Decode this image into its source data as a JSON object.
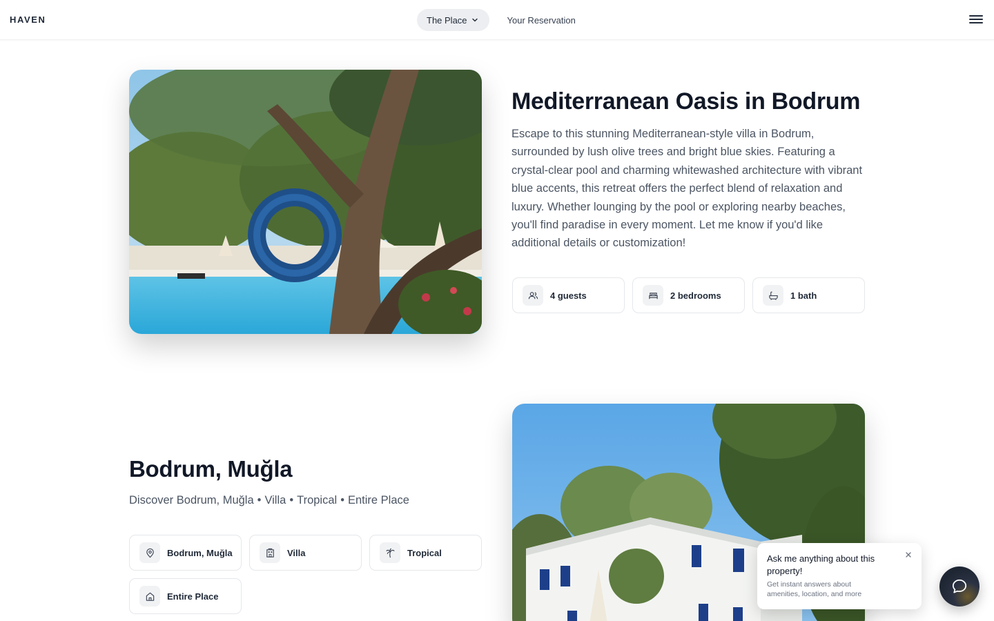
{
  "header": {
    "brand": "HAVEN",
    "nav": [
      {
        "label": "The Place",
        "active": true,
        "icon": "chevron-down-icon"
      },
      {
        "label": "Your Reservation",
        "active": false
      }
    ],
    "menu_icon": "hamburger-menu-icon"
  },
  "listing": {
    "title": "Mediterranean Oasis in Bodrum",
    "description": "Escape to this stunning Mediterranean-style villa in Bodrum, surrounded by lush olive trees and bright blue skies. Featuring a crystal-clear pool and charming whitewashed architecture with vibrant blue accents, this retreat offers the perfect blend of relaxation and luxury. Whether lounging by the pool or exploring nearby beaches, you'll find paradise in every moment. Let me know if you'd like additional details or customization!",
    "features": [
      {
        "label": "4 guests",
        "icon": "users-icon"
      },
      {
        "label": "2 bedrooms",
        "icon": "bed-icon"
      },
      {
        "label": "1 bath",
        "icon": "bath-icon"
      }
    ]
  },
  "location": {
    "title": "Bodrum, Muğla",
    "subtitle_prefix": "Discover Bodrum, Muğla",
    "subtitle_parts": [
      "Villa",
      "Tropical",
      "Entire Place"
    ],
    "separator": "•",
    "tags": [
      {
        "label": "Bodrum, Muğla",
        "icon": "map-pin-icon"
      },
      {
        "label": "Villa",
        "icon": "building-icon"
      },
      {
        "label": "Tropical",
        "icon": "palm-tree-icon"
      },
      {
        "label": "Entire Place",
        "icon": "home-icon"
      }
    ]
  },
  "chat": {
    "question": "Ask me anything about this property!",
    "subtext": "Get instant answers about amenities, location, and more",
    "close_icon": "close-icon",
    "fab_icon": "chat-bubble-icon"
  },
  "colors": {
    "text_primary": "#111827",
    "text_secondary": "#4b5563",
    "pill_bg": "#eceef1",
    "chip_border": "#e5e7eb",
    "fab_bg": "#1e2633"
  }
}
